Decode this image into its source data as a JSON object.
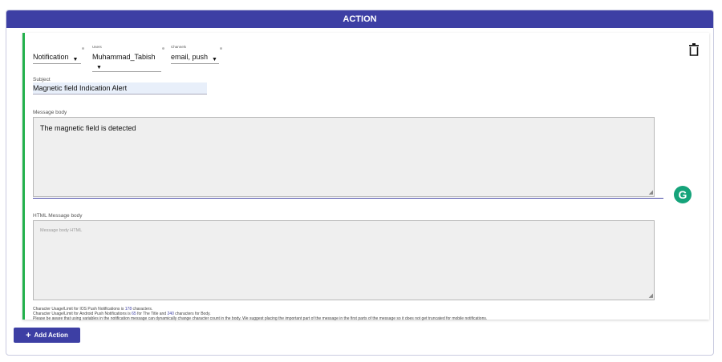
{
  "panel": {
    "title": "ACTION"
  },
  "selectors": {
    "type": {
      "caption": "",
      "value": "Notification"
    },
    "users": {
      "caption": "Users",
      "value": "Muhammad_Tabish"
    },
    "channels": {
      "caption": "Channels",
      "value": "email, push"
    }
  },
  "subject": {
    "label": "Subject",
    "value": "Magnetic field Indication Alert"
  },
  "message": {
    "label": "Message body",
    "value": "The magnetic field is detected"
  },
  "html_message": {
    "label": "HTML Message body",
    "placeholder": "Message body HTML"
  },
  "notes": {
    "ios_prefix": "Character Usage/Limit for IOS Push Notifications is ",
    "ios_count": "178",
    "ios_suffix": " characters.",
    "android_prefix": "Character Usage/Limit for Android Push Notifications is ",
    "android_title": "65",
    "android_mid": " for The Title and ",
    "android_body": "240",
    "android_suffix": " characters for Body.",
    "warning": "Please be aware that using variables in the notification message can dynamically change character count in the body. We suggest placing the important part of the message in the first parts of the message so it does not get truncated for mobile notifications."
  },
  "add_action": {
    "label": "Add Action"
  },
  "icons": {
    "delete": "trash-icon",
    "grammarly": "grammarly-icon",
    "add": "plus-icon"
  }
}
